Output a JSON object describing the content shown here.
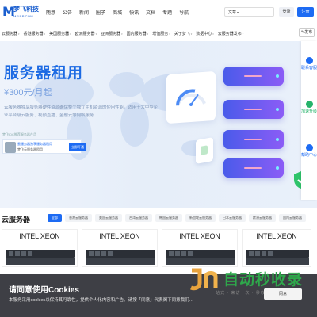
{
  "header": {
    "logo_name": "梦飞科技",
    "logo_sub": "MFISP.COM",
    "nav": [
      "随意",
      "公告",
      "新闻",
      "圈子",
      "商城",
      "快讯",
      "文档",
      "专题",
      "导航"
    ],
    "search_type": "文章",
    "search_placeholder": "",
    "login_label": "登录",
    "register_label": "注册"
  },
  "catnav": {
    "items": [
      "云服务器",
      "香港服务器",
      "美国服务器",
      "欧洲服务器",
      "亚洲服务器",
      "国内服务器",
      "增值服务",
      "关于梦飞",
      "数据中心",
      "云服务器发布"
    ],
    "publish_label": "发布"
  },
  "hero": {
    "title": "服务器租用",
    "price": "¥300元/月起",
    "desc": "云服务器独享服务器硬件资源确保整个独立主机资源的使用性能。适用于大中型企业平台级云服务、视频直播、金融云等网络服务",
    "ad_top": "梦飞IDC推荐服务器产品",
    "ad_line1": "云服务器独享服务器租用",
    "ad_line2": "梦飞云服务器租用",
    "ad_button": "立即开通"
  },
  "sidebar": {
    "items": [
      {
        "label": "联系客服",
        "color": "#1d6bf3"
      },
      {
        "label": "加速升级",
        "color": "#27b36b"
      },
      {
        "label": "帮助中心",
        "color": "#1d6bf3"
      }
    ]
  },
  "servers": {
    "title": "云服务器",
    "filters": [
      "全部",
      "香港云服务器",
      "美国云服务器",
      "台湾云服务器",
      "韩国云服务器",
      "新加坡云服务器",
      "日本云服务器",
      "欧洲云服务器",
      "国内云服务器"
    ],
    "cards": [
      "INTEL XEON",
      "INTEL XEON",
      "INTEL XEON",
      "INTEL XEON"
    ]
  },
  "cookie": {
    "title": "请同意使用Cookies",
    "desc": "本服务采用cookies以保持其可靠性，提供个人化内容和广告。请按「同意」代表阁下同意我们…",
    "agree_label": "同意"
  },
  "watermark": {
    "text": "自动秒收录",
    "sub": "一站式 · 来访一次 · 秒收录"
  }
}
